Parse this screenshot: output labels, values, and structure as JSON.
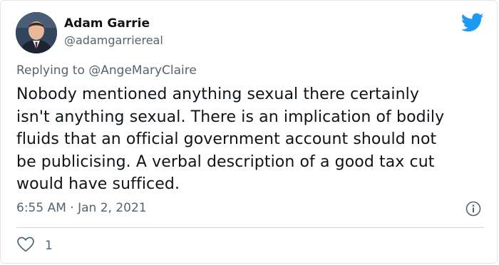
{
  "author": {
    "name": "Adam Garrie",
    "handle": "@adamgarriereal",
    "avatar_icon": "profile-photo"
  },
  "reply": {
    "prefix": "Replying to ",
    "mention": "@AngeMaryClaire"
  },
  "tweet": {
    "lines": [
      "Nobody mentioned anything sexual there certainly",
      "isn't anything sexual. There is an implication of bodily",
      "fluids that an official government account should not",
      "be publicising. A verbal description of a good tax cut",
      "would have sufficed."
    ],
    "timestamp": "6:55 AM · Jan 2, 2021"
  },
  "actions": {
    "like_icon": "heart-outline-icon",
    "like_count": "1",
    "info_icon": "info-circle-icon"
  },
  "colors": {
    "brand": "#1d9bf0",
    "text": "#0f1419",
    "muted": "#536471",
    "divider": "#cfd9de"
  }
}
